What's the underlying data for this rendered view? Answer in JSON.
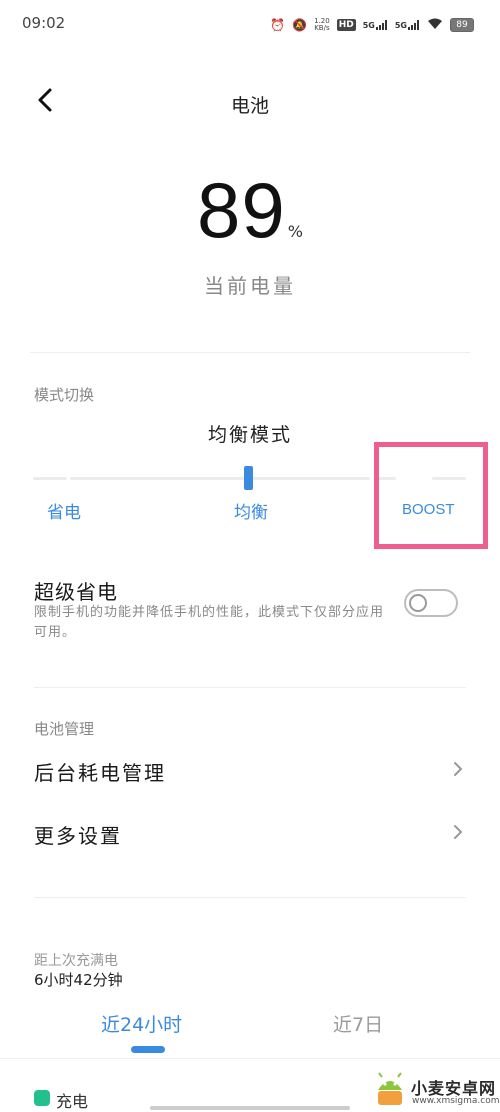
{
  "status_bar": {
    "time": "09:02",
    "speed_value": "1.20",
    "speed_unit": "KB/s",
    "hd_label": "HD",
    "sim1_label": "5G",
    "sim2_label": "5G",
    "battery_level": "89"
  },
  "header": {
    "back_icon": "chevron-left-icon",
    "title": "电池"
  },
  "battery": {
    "percent": "89",
    "unit": "%",
    "caption": "当前电量"
  },
  "mode_switch": {
    "section_label": "模式切换",
    "current_mode": "均衡模式",
    "options": [
      "省电",
      "均衡",
      "BOOST"
    ],
    "selected_index": 1,
    "accent_color": "#3a8be0",
    "highlight_color": "#ee5e8e"
  },
  "super_save": {
    "title": "超级省电",
    "description": "限制手机的功能并降低手机的性能，此模式下仅部分应用可用。",
    "enabled": false
  },
  "battery_management": {
    "section_label": "电池管理",
    "items": [
      {
        "label": "后台耗电管理",
        "icon": "chevron-right-icon"
      },
      {
        "label": "更多设置",
        "icon": "chevron-right-icon"
      }
    ]
  },
  "stats": {
    "since_full_label": "距上次充满电",
    "since_full_value": "6小时42分钟",
    "tabs": [
      "近24小时",
      "近7日"
    ],
    "active_tab": 0,
    "legend": [
      {
        "label": "充电",
        "color": "#22c08b"
      }
    ]
  },
  "watermark": {
    "name": "小麦安卓网",
    "url": "www.xmsigma.com"
  }
}
